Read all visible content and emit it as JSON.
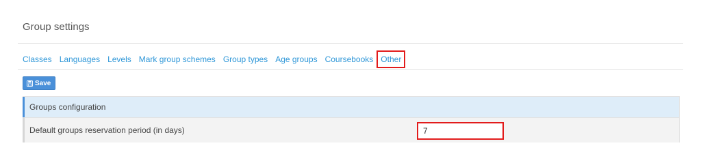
{
  "page": {
    "title": "Group settings"
  },
  "tabs": [
    {
      "label": "Classes"
    },
    {
      "label": "Languages"
    },
    {
      "label": "Levels"
    },
    {
      "label": "Mark group schemes"
    },
    {
      "label": "Group types"
    },
    {
      "label": "Age groups"
    },
    {
      "label": "Coursebooks"
    },
    {
      "label": "Other",
      "active": true
    }
  ],
  "toolbar": {
    "save_label": "Save",
    "save_icon": "floppy-disk-icon"
  },
  "groups_configuration": {
    "header": "Groups configuration",
    "fields": [
      {
        "label": "Default groups reservation period (in days)",
        "value": "7"
      }
    ]
  },
  "colors": {
    "link": "#2f97d8",
    "accent": "#4a90d9",
    "highlight_border": "#e21b1b",
    "panel_header_bg": "#deedf9"
  }
}
